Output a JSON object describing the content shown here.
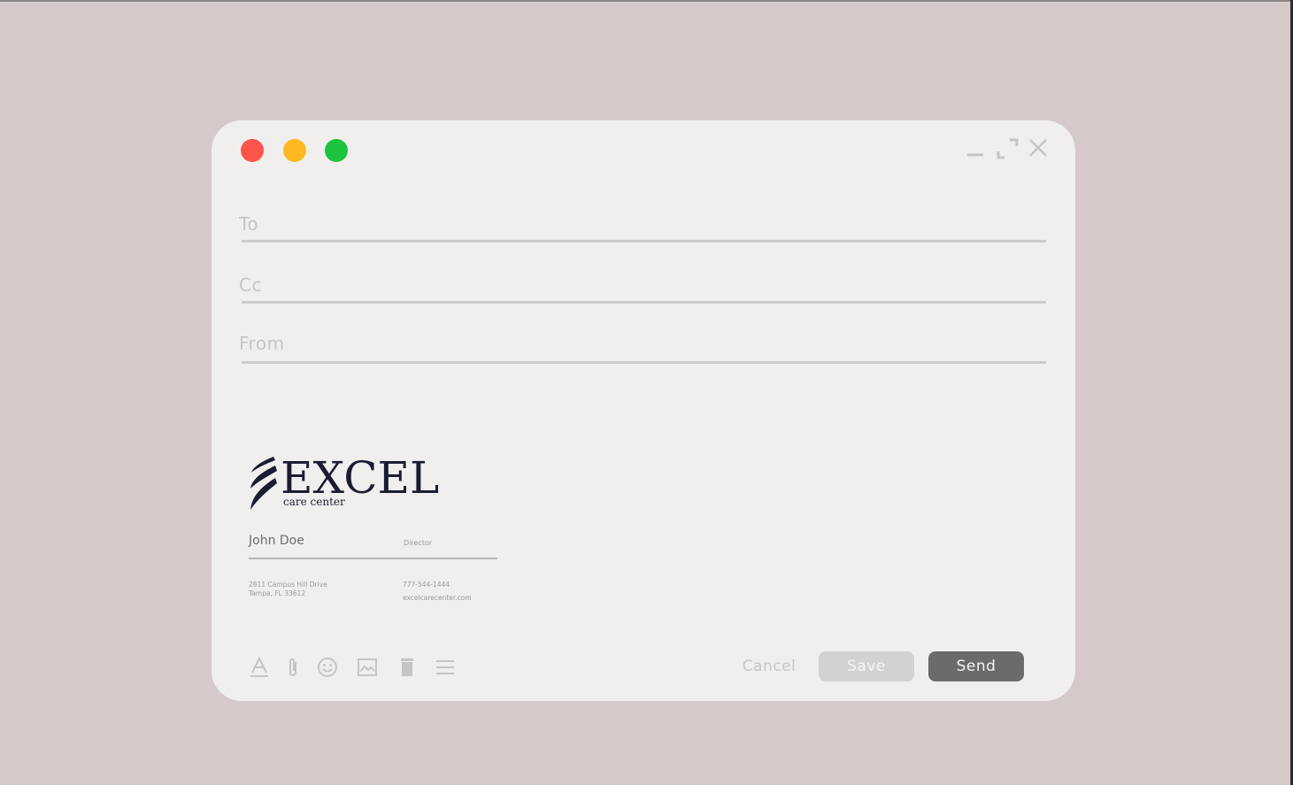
{
  "window": {
    "controls": [
      "minimize-icon",
      "maximize-icon",
      "close-icon"
    ],
    "traffic_lights": {
      "red": "#fd5549",
      "yellow": "#fdb922",
      "green": "#1dc33f"
    }
  },
  "fields": {
    "to_label": "To",
    "cc_label": "Cc",
    "from_label": "From"
  },
  "signature": {
    "logo_word": "EXCEL",
    "logo_sub": "care center",
    "name": "John Doe",
    "title": "Director",
    "address_line1": "2811 Campus Hill Drive",
    "address_line2": "Tampa, FL 33612",
    "phone": "777-544-1444",
    "website": "excelcarecenter.com",
    "brand_color": "#1b1c33"
  },
  "toolbar": {
    "icons": [
      "text-format-icon",
      "attachment-icon",
      "emoji-icon",
      "image-icon",
      "trash-icon",
      "more-menu-icon"
    ],
    "cancel_label": "Cancel",
    "save_label": "Save",
    "send_label": "Send"
  }
}
